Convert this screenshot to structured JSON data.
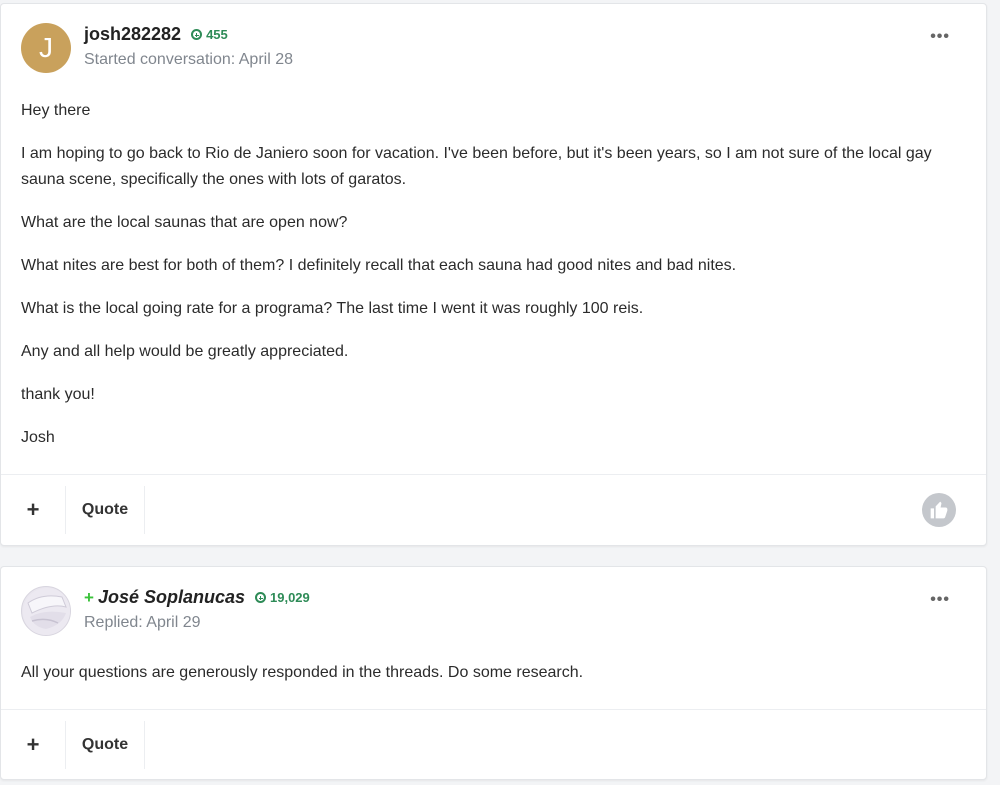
{
  "posts": [
    {
      "avatar_letter": "J",
      "username": "josh282282",
      "reputation": "455",
      "subline": "Started conversation: April 28",
      "paragraphs": [
        "Hey there",
        "I am hoping to go back to Rio de Janiero soon for vacation.  I've been before, but it's been years, so I am not sure of the local gay sauna scene, specifically the ones with lots of garatos.",
        "What are the local saunas that are open now?",
        "What nites are best for both of them?  I definitely recall that each sauna had good nites and bad nites.",
        "What is the local going rate for a programa? The last time I went it was roughly 100 reis.",
        "Any and all help would be greatly appreciated.",
        "thank you!",
        "Josh"
      ],
      "more_label": "•••",
      "plus_label": "+",
      "quote_label": "Quote"
    },
    {
      "username_prefix": "+",
      "username": "José Soplanucas",
      "reputation": "19,029",
      "subline": "Replied: April 29",
      "paragraphs": [
        "All your questions are generously responded in the threads. Do some research."
      ],
      "more_label": "•••",
      "plus_label": "+",
      "quote_label": "Quote"
    }
  ],
  "colors": {
    "avatar_bg": "#c9a15c",
    "reputation": "#2e8b57",
    "plus_badge": "#3ac23a",
    "like_button": "#c4c7cc"
  },
  "icons": {
    "reputation": "reputation-plus-icon",
    "like": "thumbs-up-icon",
    "more": "ellipsis-icon"
  }
}
